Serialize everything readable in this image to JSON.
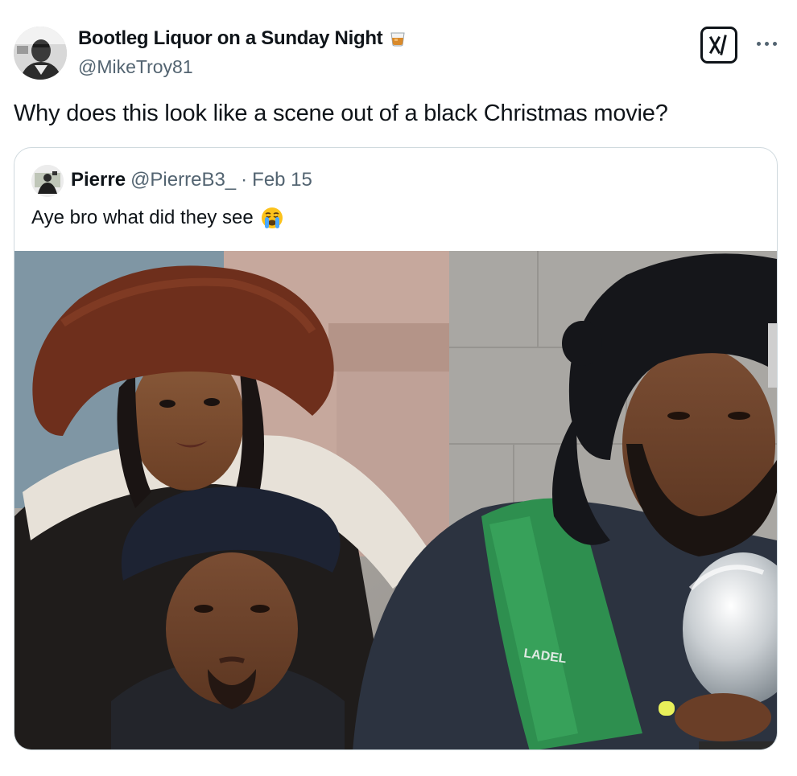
{
  "tweet": {
    "display_name": "Bootleg Liquor on a Sunday Night",
    "name_emoji": "tumbler-glass-emoji",
    "handle": "@MikeTroy81",
    "text": "Why does this look like a scene out of a black Christmas movie?",
    "actions": {
      "grok_icon": "grok-icon",
      "more_icon": "more-icon"
    }
  },
  "quote": {
    "display_name": "Pierre",
    "handle": "@PierreB3_",
    "separator": "·",
    "date": "Feb 15",
    "text": "Aye bro what did they see",
    "text_emoji": "loudly-crying-face-emoji",
    "media_jersey_text": "LADEL"
  },
  "colors": {
    "text_primary": "#0f1419",
    "text_secondary": "#536471",
    "card_border": "#cfd9de"
  }
}
